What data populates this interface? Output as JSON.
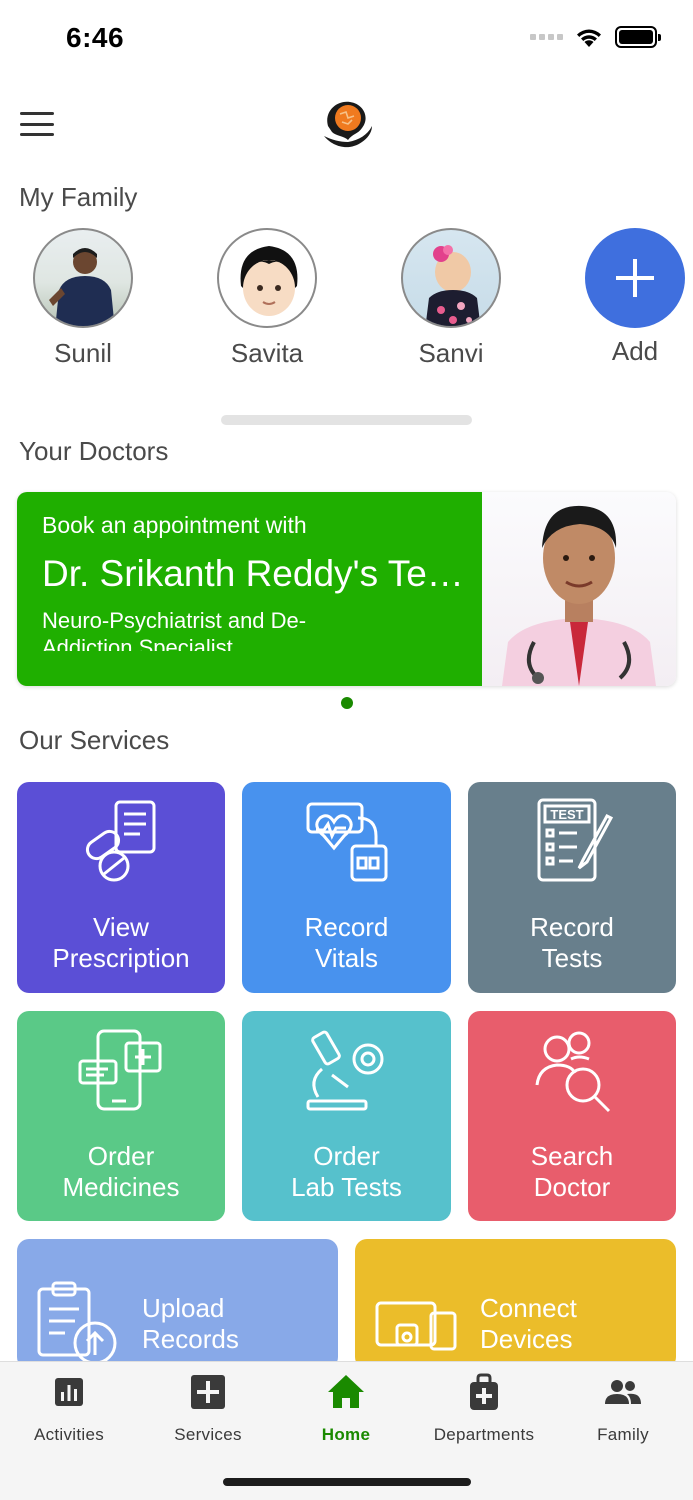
{
  "status_bar": {
    "time": "6:46"
  },
  "sections": {
    "family_title": "My Family",
    "doctors_title": "Your Doctors",
    "services_title": "Our Services"
  },
  "family": {
    "members": [
      {
        "name": "Sunil"
      },
      {
        "name": "Savita"
      },
      {
        "name": "Sanvi"
      }
    ],
    "add_label": "Add"
  },
  "doctor_card": {
    "intro": "Book an appointment with",
    "name": "Dr. Srikanth Reddy's Te…",
    "specialty": "Neuro-Psychiatrist and De-Addiction Specialist"
  },
  "services": [
    {
      "label_1": "View",
      "label_2": "Prescription",
      "color": "#5b4fd6",
      "icon": "prescription-icon"
    },
    {
      "label_1": "Record",
      "label_2": "Vitals",
      "color": "#4892ee",
      "icon": "vitals-icon"
    },
    {
      "label_1": "Record",
      "label_2": "Tests",
      "color": "#687f8c",
      "icon": "test-icon"
    },
    {
      "label_1": "Order",
      "label_2": "Medicines",
      "color": "#5ac987",
      "icon": "medicines-icon"
    },
    {
      "label_1": "Order",
      "label_2": "Lab Tests",
      "color": "#56c1cc",
      "icon": "microscope-icon"
    },
    {
      "label_1": "Search",
      "label_2": "Doctor",
      "color": "#e85d6c",
      "icon": "search-doctor-icon"
    },
    {
      "label_1": "Upload",
      "label_2": "Records",
      "color": "#88a9e8",
      "icon": "upload-records-icon"
    },
    {
      "label_1": "Connect",
      "label_2": "Devices",
      "color": "#ebbd2a",
      "icon": "devices-icon"
    }
  ],
  "bottom_nav": {
    "items": [
      {
        "label": "Activities",
        "icon": "chart-icon"
      },
      {
        "label": "Services",
        "icon": "plus-square-icon"
      },
      {
        "label": "Home",
        "icon": "home-icon",
        "active": true
      },
      {
        "label": "Departments",
        "icon": "medical-bag-icon"
      },
      {
        "label": "Family",
        "icon": "people-icon"
      }
    ],
    "active_color": "#1a8a00"
  }
}
